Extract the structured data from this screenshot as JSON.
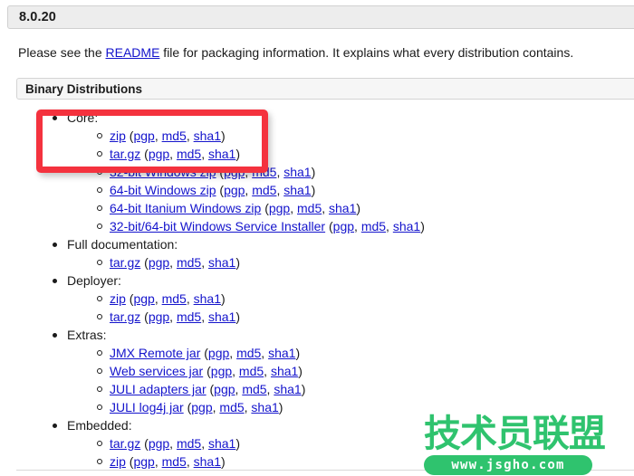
{
  "version_header": {
    "label": "8.0.20"
  },
  "intro": {
    "before": "Please see the ",
    "link": "README",
    "after": " file for packaging information. It explains what every distribution contains."
  },
  "section_header": {
    "label": "Binary Distributions"
  },
  "checksums": {
    "pgp": "pgp",
    "md5": "md5",
    "sha1": "sha1",
    "open_paren": "(",
    "close_paren": ")",
    "separator": ", "
  },
  "groups": [
    {
      "title": "Core:",
      "items": [
        {
          "name": "zip"
        },
        {
          "name": "tar.gz"
        },
        {
          "name": "32-bit Windows zip"
        },
        {
          "name": "64-bit Windows zip"
        },
        {
          "name": "64-bit Itanium Windows zip"
        },
        {
          "name": "32-bit/64-bit Windows Service Installer"
        }
      ]
    },
    {
      "title": "Full documentation:",
      "items": [
        {
          "name": "tar.gz"
        }
      ]
    },
    {
      "title": "Deployer:",
      "items": [
        {
          "name": "zip"
        },
        {
          "name": "tar.gz"
        }
      ]
    },
    {
      "title": "Extras:",
      "items": [
        {
          "name": "JMX Remote jar"
        },
        {
          "name": "Web services jar"
        },
        {
          "name": "JULI adapters jar"
        },
        {
          "name": "JULI log4j jar"
        }
      ]
    },
    {
      "title": "Embedded:",
      "items": [
        {
          "name": "tar.gz"
        },
        {
          "name": "zip"
        }
      ]
    }
  ],
  "annotation": {
    "color": "#f4323e",
    "target": "Core zip and tar.gz downloads"
  },
  "watermark": {
    "title": "技术员联盟",
    "url": "www.jsgho.com",
    "color": "#2fc36e"
  }
}
